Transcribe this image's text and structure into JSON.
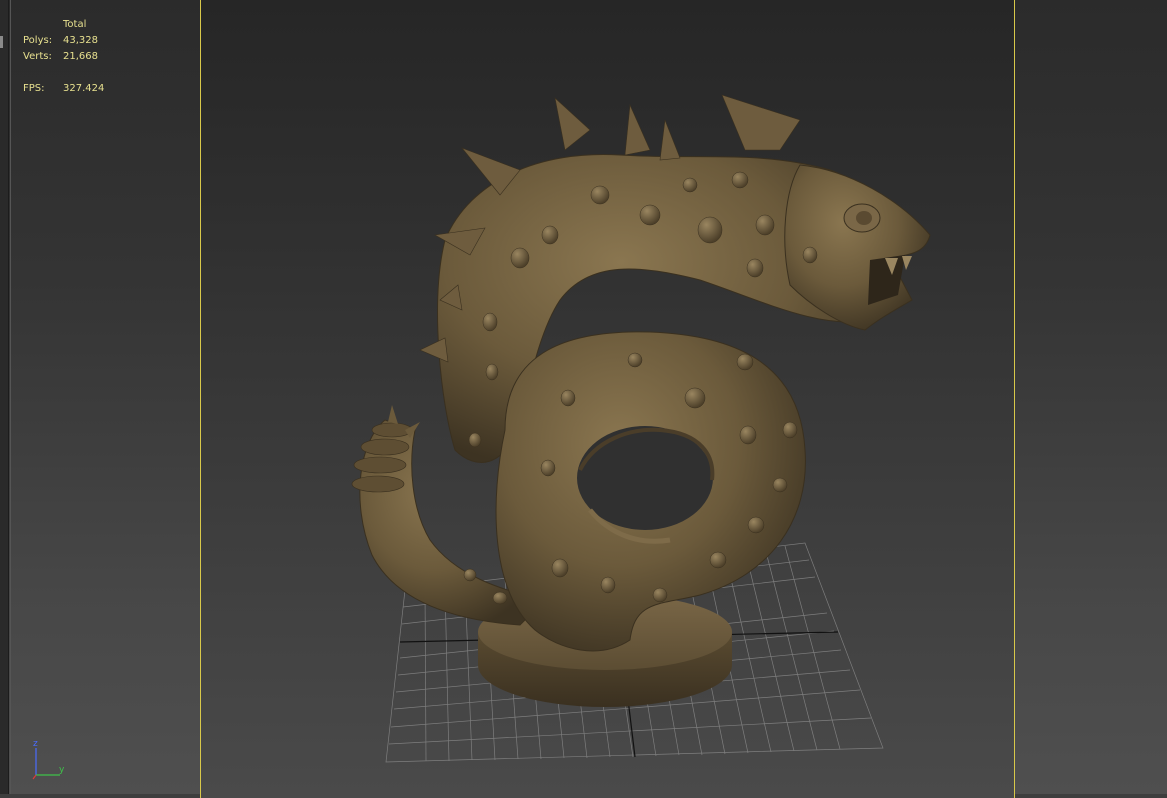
{
  "stats": {
    "header": "Total",
    "polys_label": "Polys:",
    "polys_value": "43,328",
    "verts_label": "Verts:",
    "verts_value": "21,668",
    "fps_label": "FPS:",
    "fps_value": "327.424"
  },
  "axis_gizmo": {
    "z_label": "z",
    "y_label": "y",
    "z_color": "#4a6cff",
    "y_color": "#3fc24a",
    "x_color": "#e03a3a"
  },
  "colors": {
    "safe_frame": "#d8c84a",
    "stats_text": "#e7e08f",
    "model": "#6e5c3e",
    "grid": "#9a9a9a"
  },
  "model": {
    "icon": "serpent-dragon-model"
  }
}
